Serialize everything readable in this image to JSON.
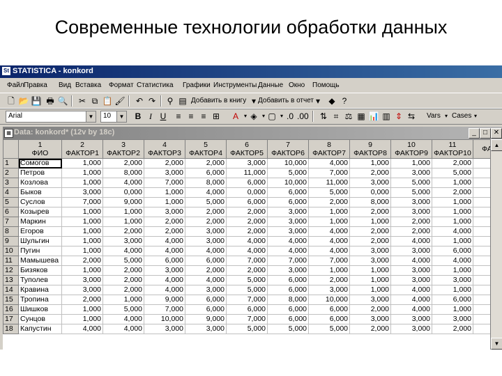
{
  "slide_title": "Современные технологии обработки данных",
  "app": {
    "title": "STATISTICA - konkord",
    "icon_label": "St"
  },
  "menu": [
    "Файл",
    "Правка",
    "Вид",
    "Вставка",
    "Формат",
    "Статистика",
    "Графики",
    "Инструменты",
    "Данные",
    "Окно",
    "Помощь"
  ],
  "toolbar1": {
    "add_to_workbook": "Добавить в книгу",
    "add_to_report": "Добавить в отчет"
  },
  "toolbar2": {
    "font_name": "Arial",
    "font_size": "10",
    "vars_label": "Vars",
    "cases_label": "Cases"
  },
  "window": {
    "title": "Data: konkord* (12v by 18c)"
  },
  "table": {
    "col_numbers": [
      "1",
      "2",
      "3",
      "4",
      "5",
      "6",
      "7",
      "8",
      "9",
      "10",
      "11",
      ""
    ],
    "col_names": [
      "ФИО",
      "ФАКТОР1",
      "ФАКТОР2",
      "ФАКТОР3",
      "ФАКТОР4",
      "ФАКТОР5",
      "ФАКТОР6",
      "ФАКТОР7",
      "ФАКТОР8",
      "ФАКТОР9",
      "ФАКТОР10",
      "ФА"
    ],
    "rows": [
      [
        "1",
        "Сомогов",
        "1,000",
        "2,000",
        "2,000",
        "2,000",
        "3,000",
        "10,000",
        "4,000",
        "1,000",
        "1,000",
        "2,000"
      ],
      [
        "2",
        "Петров",
        "1,000",
        "8,000",
        "3,000",
        "6,000",
        "11,000",
        "5,000",
        "7,000",
        "2,000",
        "3,000",
        "5,000"
      ],
      [
        "3",
        "Козлова",
        "1,000",
        "4,000",
        "7,000",
        "8,000",
        "6,000",
        "10,000",
        "11,000",
        "3,000",
        "5,000",
        "1,000"
      ],
      [
        "4",
        "Быков",
        "3,000",
        "0,000",
        "1,000",
        "4,000",
        "0,000",
        "6,000",
        "5,000",
        "0,000",
        "5,000",
        "2,000"
      ],
      [
        "5",
        "Суслов",
        "7,000",
        "9,000",
        "1,000",
        "5,000",
        "6,000",
        "6,000",
        "2,000",
        "8,000",
        "3,000",
        "1,000"
      ],
      [
        "6",
        "Козырев",
        "1,000",
        "1,000",
        "3,000",
        "2,000",
        "2,000",
        "3,000",
        "1,000",
        "2,000",
        "3,000",
        "1,000"
      ],
      [
        "7",
        "Маркин",
        "1,000",
        "1,000",
        "2,000",
        "2,000",
        "2,000",
        "3,000",
        "1,000",
        "1,000",
        "2,000",
        "1,000"
      ],
      [
        "8",
        "Егоров",
        "1,000",
        "2,000",
        "2,000",
        "3,000",
        "2,000",
        "3,000",
        "4,000",
        "2,000",
        "2,000",
        "4,000"
      ],
      [
        "9",
        "Шульгин",
        "1,000",
        "3,000",
        "4,000",
        "3,000",
        "4,000",
        "4,000",
        "4,000",
        "2,000",
        "4,000",
        "1,000"
      ],
      [
        "10",
        "Пугин",
        "1,000",
        "4,000",
        "4,000",
        "4,000",
        "4,000",
        "4,000",
        "4,000",
        "3,000",
        "3,000",
        "6,000"
      ],
      [
        "11",
        "Мамышева",
        "2,000",
        "5,000",
        "6,000",
        "6,000",
        "7,000",
        "7,000",
        "7,000",
        "3,000",
        "4,000",
        "4,000"
      ],
      [
        "12",
        "Бизяков",
        "1,000",
        "2,000",
        "3,000",
        "2,000",
        "2,000",
        "3,000",
        "1,000",
        "1,000",
        "3,000",
        "1,000"
      ],
      [
        "13",
        "Туполев",
        "3,000",
        "2,000",
        "4,000",
        "4,000",
        "5,000",
        "6,000",
        "2,000",
        "1,000",
        "3,000",
        "3,000"
      ],
      [
        "14",
        "Кравина",
        "3,000",
        "2,000",
        "4,000",
        "3,000",
        "5,000",
        "6,000",
        "3,000",
        "1,000",
        "4,000",
        "1,000"
      ],
      [
        "15",
        "Тропина",
        "2,000",
        "1,000",
        "9,000",
        "6,000",
        "7,000",
        "8,000",
        "10,000",
        "3,000",
        "4,000",
        "6,000"
      ],
      [
        "16",
        "Шишков",
        "1,000",
        "5,000",
        "7,000",
        "6,000",
        "6,000",
        "6,000",
        "6,000",
        "2,000",
        "4,000",
        "1,000"
      ],
      [
        "17",
        "Сунцов",
        "1,000",
        "4,000",
        "10,000",
        "9,000",
        "7,000",
        "6,000",
        "6,000",
        "3,000",
        "3,000",
        "3,000"
      ],
      [
        "18",
        "Капустин",
        "4,000",
        "4,000",
        "3,000",
        "3,000",
        "5,000",
        "5,000",
        "5,000",
        "2,000",
        "3,000",
        "2,000"
      ]
    ]
  }
}
